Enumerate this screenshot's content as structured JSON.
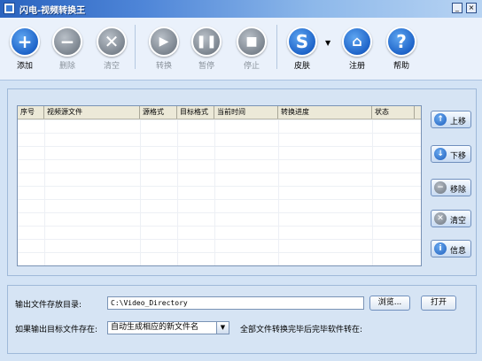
{
  "window": {
    "title": "闪电-视频转换王"
  },
  "titlebar_buttons": {
    "minimize": "_",
    "close": "×"
  },
  "toolbar": {
    "add": "添加",
    "delete": "删除",
    "clear": "清空",
    "convert": "转换",
    "pause": "暂停",
    "stop": "停止",
    "skin": "皮肤",
    "register": "注册",
    "help": "帮助",
    "skin_glyph": "S",
    "dropdown_glyph": "▼"
  },
  "file_list": {
    "columns": [
      "序号",
      "视频源文件",
      "源格式",
      "目标格式",
      "当前时间",
      "转换进度",
      "状态"
    ]
  },
  "side_buttons": {
    "move_up": "上移",
    "move_down": "下移",
    "remove": "移除",
    "clear": "清空",
    "info": "信息"
  },
  "output": {
    "dir_label": "输出文件存放目录:",
    "dir_value": "C:\\Video_Directory",
    "browse": "浏览...",
    "open": "打开",
    "exists_label": "如果输出目标文件存在:",
    "exists_option": "自动生成相应的新文件名",
    "after_label": "全部文件转换完毕后完毕软件转在:"
  },
  "colors": {
    "accent": "#1e64c9",
    "disabled": "#7c858f"
  }
}
